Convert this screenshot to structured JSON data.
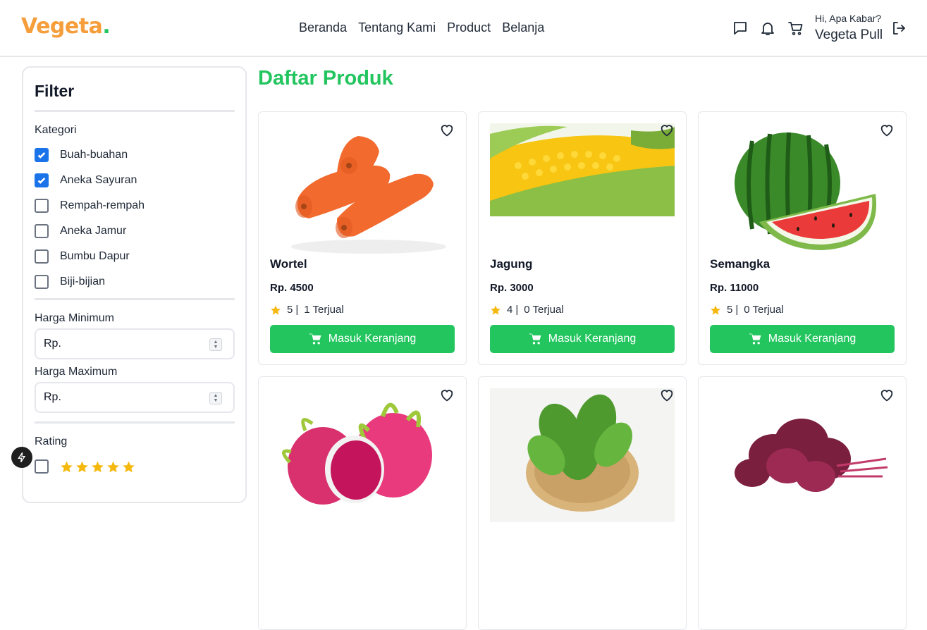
{
  "header": {
    "logo_text": "Vegeta",
    "logo_dot": ".",
    "nav": [
      "Beranda",
      "Tentang Kami",
      "Product",
      "Belanja"
    ],
    "greeting": "Hi, Apa Kabar?",
    "username": "Vegeta Pull"
  },
  "sidebar": {
    "title": "Filter",
    "category_label": "Kategori",
    "categories": [
      {
        "label": "Buah-buahan",
        "checked": true
      },
      {
        "label": "Aneka Sayuran",
        "checked": true
      },
      {
        "label": "Rempah-rempah",
        "checked": false
      },
      {
        "label": "Aneka Jamur",
        "checked": false
      },
      {
        "label": "Bumbu Dapur",
        "checked": false
      },
      {
        "label": "Biji-bijian",
        "checked": false
      }
    ],
    "min_price_label": "Harga Minimum",
    "min_price_placeholder": "Rp.",
    "max_price_label": "Harga Maximum",
    "max_price_placeholder": "Rp.",
    "rating_label": "Rating",
    "rating_option_stars": 5
  },
  "main": {
    "title": "Daftar Produk",
    "add_to_cart_label": "Masuk Keranjang",
    "products": [
      {
        "name": "Wortel",
        "price": "Rp. 4500",
        "rating": "5",
        "sold": "1 Terjual"
      },
      {
        "name": "Jagung",
        "price": "Rp. 3000",
        "rating": "4",
        "sold": "0 Terjual"
      },
      {
        "name": "Semangka",
        "price": "Rp. 11000",
        "rating": "5",
        "sold": "0 Terjual"
      },
      {
        "name": "",
        "price": "",
        "rating": "",
        "sold": ""
      },
      {
        "name": "",
        "price": "",
        "rating": "",
        "sold": ""
      },
      {
        "name": "",
        "price": "",
        "rating": "",
        "sold": ""
      }
    ]
  },
  "colors": {
    "brand_orange": "#f59e3b",
    "brand_green": "#22c55e",
    "checkbox_blue": "#1a73e8",
    "star_yellow": "#f5b80c"
  },
  "icons": [
    "chat-icon",
    "bell-icon",
    "cart-icon",
    "logout-icon",
    "heart-icon",
    "star-icon",
    "cart-add-icon",
    "bolt-icon"
  ]
}
